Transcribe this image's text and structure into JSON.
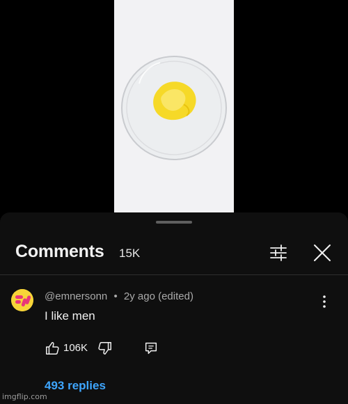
{
  "comments_panel": {
    "title": "Comments",
    "count": "15K"
  },
  "comment": {
    "author": "@emnersonn",
    "separator": "•",
    "time": "2y ago (edited)",
    "text": "I like men",
    "likes": "106K",
    "replies_label": "493 replies"
  },
  "watermark": "imgflip.com",
  "colors": {
    "sheet_bg": "#0f0f0f",
    "link_blue": "#3ea6ff",
    "avatar_yellow": "#f7d438",
    "avatar_pink": "#e8367a",
    "egg_yellow": "#f9e03a"
  },
  "icons": [
    "filter-icon",
    "close-icon",
    "more-options-icon",
    "thumbs-up-icon",
    "thumbs-down-icon",
    "reply-icon"
  ]
}
